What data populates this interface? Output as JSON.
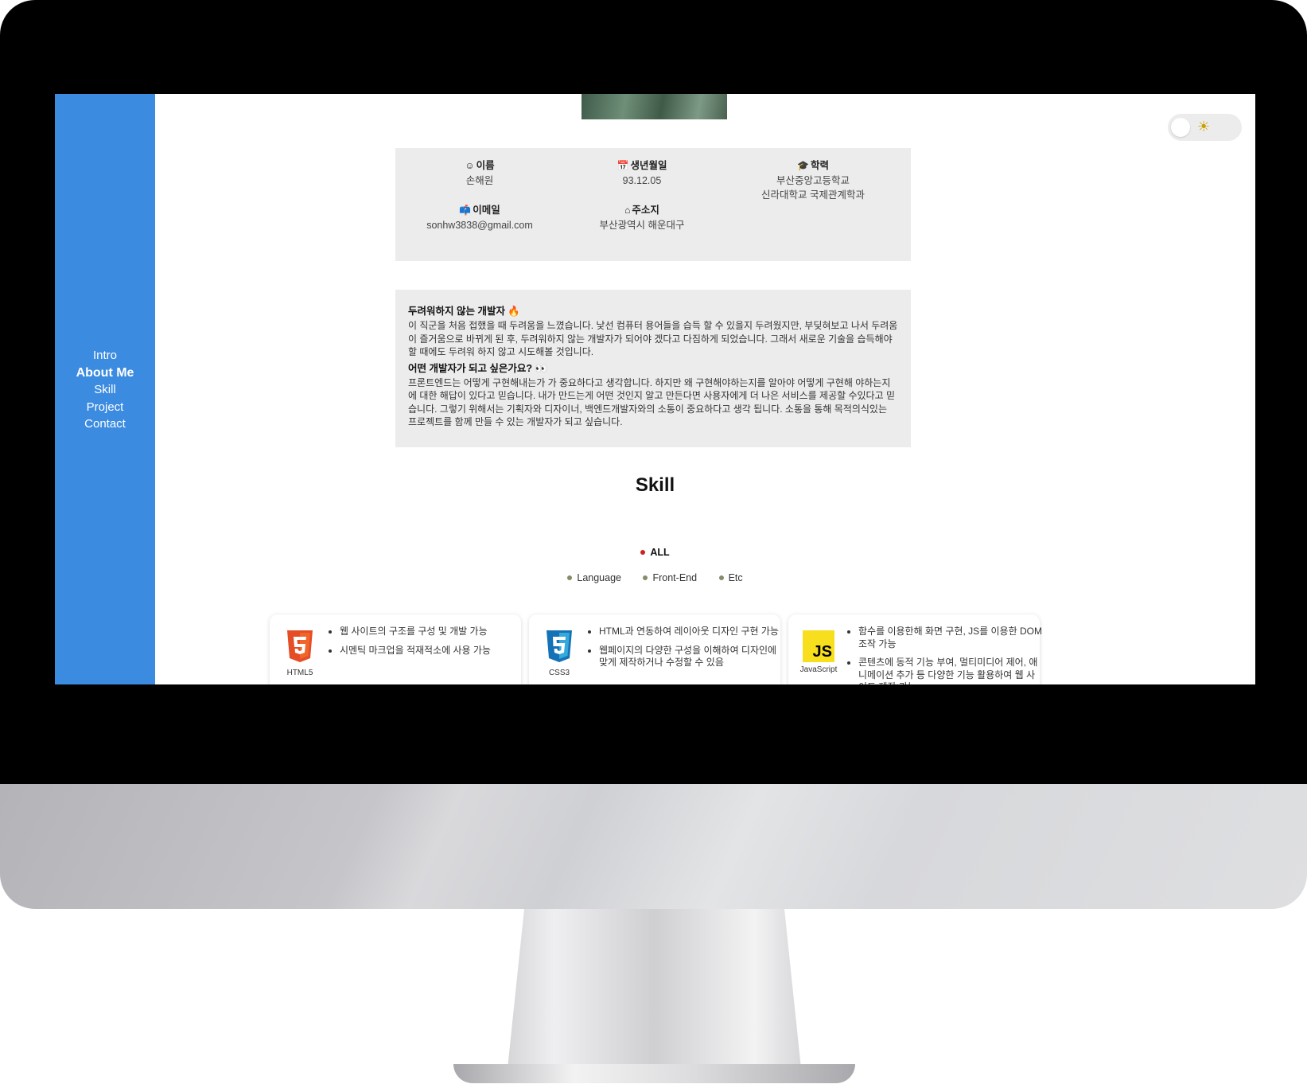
{
  "nav": {
    "items": [
      {
        "label": "Intro",
        "active": false
      },
      {
        "label": "About Me",
        "active": true
      },
      {
        "label": "Skill",
        "active": false
      },
      {
        "label": "Project",
        "active": false
      },
      {
        "label": "Contact",
        "active": false
      }
    ]
  },
  "theme_toggle": {
    "icon": "sun-icon",
    "glyph": "☀"
  },
  "info": {
    "name": {
      "icon": "smile-icon",
      "glyph": "☺",
      "label": "이름",
      "value": "손해원"
    },
    "birth": {
      "icon": "calendar-icon",
      "glyph": "📅",
      "label": "생년월일",
      "value": "93.12.05"
    },
    "education": {
      "icon": "graduation-cap-icon",
      "glyph": "🎓",
      "label": "학력",
      "value_line1": "부산중앙고등학교",
      "value_line2": "신라대학교 국제관계학과"
    },
    "email": {
      "icon": "mailbox-icon",
      "glyph": "📫",
      "label": "이메일",
      "value": "sonhw3838@gmail.com"
    },
    "address": {
      "icon": "house-icon",
      "glyph": "⌂",
      "label": "주소지",
      "value": "부산광역시 해운대구"
    }
  },
  "about": {
    "heading1": "두려워하지 않는 개발자 🔥",
    "text1": "이 직군을 처음 접했을 때 두려움을 느꼈습니다. 낯선 컴퓨터 용어들을 습득 할 수 있을지 두려웠지만, 부딪혀보고 나서 두려움이 즐거움으로 바뀌게 된 후, 두려워하지 않는 개발자가 되어야 겠다고 다짐하게 되었습니다. 그래서 새로운 기술을 습득해야할 때에도 두려워 하지 않고 시도해볼 것입니다.",
    "heading2": "어떤 개발자가 되고 싶은가요? 👀",
    "text2": "프론트엔드는 어떻게 구현해내는가 가 중요하다고 생각합니다. 하지만 왜 구현해야하는지를 알아야 어떻게 구현해 야하는지에 대한 해답이 있다고 믿습니다. 내가 만드는게 어떤 것인지 알고 만든다면 사용자에게 더 나은 서비스를 제공할 수있다고 믿습니다. 그렇기 위해서는 기획자와 디자이너, 백엔드개발자와의 소통이 중요하다고 생각 됩니다. 소통을 통해 목적의식있는 프로젝트를 함께 만들 수 있는 개발자가 되고 싶습니다."
  },
  "skill": {
    "title": "Skill",
    "filter_all": "ALL",
    "filters": [
      "Language",
      "Front-End",
      "Etc"
    ],
    "colors": {
      "active_dot": "#cc2222",
      "dot": "#8a8a6a",
      "html5": "#e44d26",
      "css3": "#2965f1",
      "js": "#f7df1e"
    },
    "cards": [
      {
        "name": "HTML5",
        "icon": "html5-logo-icon",
        "items": [
          "웹 사이트의 구조를 구성 및 개발 가능",
          "시멘틱 마크업을 적재적소에 사용 가능"
        ]
      },
      {
        "name": "CSS3",
        "icon": "css3-logo-icon",
        "items": [
          "HTML과 연동하여 레이아웃 디자인 구현 가능",
          "웹페이지의 다양한 구성을 이해하여 디자인에 맞게 제작하거나 수정할 수 있음"
        ]
      },
      {
        "name": "JavaScript",
        "icon": "javascript-logo-icon",
        "logo_text": "JS",
        "items": [
          "함수를 이용한해 화면 구현, JS를 이용한 DOM 조작 가능",
          "콘텐츠에 동적 기능 부여, 멀티미디어 제어, 애니메이션 추가 등 다양한 기능 활용하여 웹 사이트 제작 가능"
        ]
      }
    ]
  }
}
